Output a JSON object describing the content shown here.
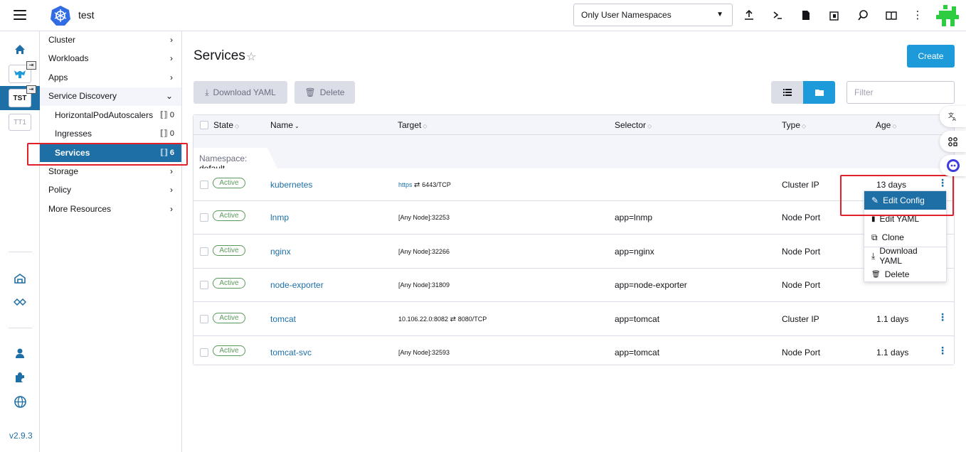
{
  "header": {
    "cluster_name": "test",
    "namespace_filter": "Only User Namespaces",
    "icons": [
      "upload-icon",
      "kubectl-shell-icon",
      "kubeconfig-icon",
      "copy-kubeconfig-icon",
      "search-icon",
      "docs-icon",
      "more-icon"
    ]
  },
  "rail": {
    "clusters": [
      "TST",
      "TT1"
    ],
    "version": "v2.9.3"
  },
  "sidebar": {
    "groups": {
      "cluster": "Cluster",
      "workloads": "Workloads",
      "apps": "Apps",
      "service_discovery": "Service Discovery",
      "storage": "Storage",
      "policy": "Policy",
      "more_resources": "More Resources"
    },
    "sub_items": [
      {
        "label": "HorizontalPodAutoscalers",
        "count": "0"
      },
      {
        "label": "Ingresses",
        "count": "0"
      },
      {
        "label": "Services",
        "count": "6"
      }
    ]
  },
  "main": {
    "title": "Services",
    "create_label": "Create",
    "download_yaml_label": "Download YAML",
    "delete_label": "Delete",
    "filter_placeholder": "Filter"
  },
  "table": {
    "columns": {
      "state": "State",
      "name": "Name",
      "target": "Target",
      "selector": "Selector",
      "type": "Type",
      "age": "Age"
    },
    "group_label": "Namespace:",
    "group_value": "default",
    "rows": [
      {
        "state": "Active",
        "name": "kubernetes",
        "target_prefix": "https",
        "target_suffix": "6443/TCP",
        "selector": "",
        "type": "Cluster IP",
        "age": "13 days"
      },
      {
        "state": "Active",
        "name": "lnmp",
        "target_prefix": "[Any Node]:32253",
        "target_suffix": "",
        "selector": "app=lnmp",
        "type": "Node Port",
        "age": ""
      },
      {
        "state": "Active",
        "name": "nginx",
        "target_prefix": "[Any Node]:32266",
        "target_suffix": "",
        "selector": "app=nginx",
        "type": "Node Port",
        "age": ""
      },
      {
        "state": "Active",
        "name": "node-exporter",
        "target_prefix": "[Any Node]:31809",
        "target_suffix": "",
        "selector": "app=node-exporter",
        "type": "Node Port",
        "age": ""
      },
      {
        "state": "Active",
        "name": "tomcat",
        "target_prefix": "10.106.22.0:8082",
        "target_suffix": "8080/TCP",
        "selector": "app=tomcat",
        "type": "Cluster IP",
        "age": "1.1 days"
      },
      {
        "state": "Active",
        "name": "tomcat-svc",
        "target_prefix": "[Any Node]:32593",
        "target_suffix": "",
        "selector": "app=tomcat",
        "type": "Node Port",
        "age": "1.1 days"
      }
    ]
  },
  "action_menu": {
    "items": [
      "Edit Config",
      "Edit YAML",
      "Clone",
      "Download YAML",
      "Delete"
    ],
    "highlighted": "Edit Config"
  },
  "colors": {
    "accent": "#1d6fa5",
    "primary_button": "#1d9ad9",
    "active_badge": "#5d995d",
    "annotation_red": "#e0212b"
  }
}
